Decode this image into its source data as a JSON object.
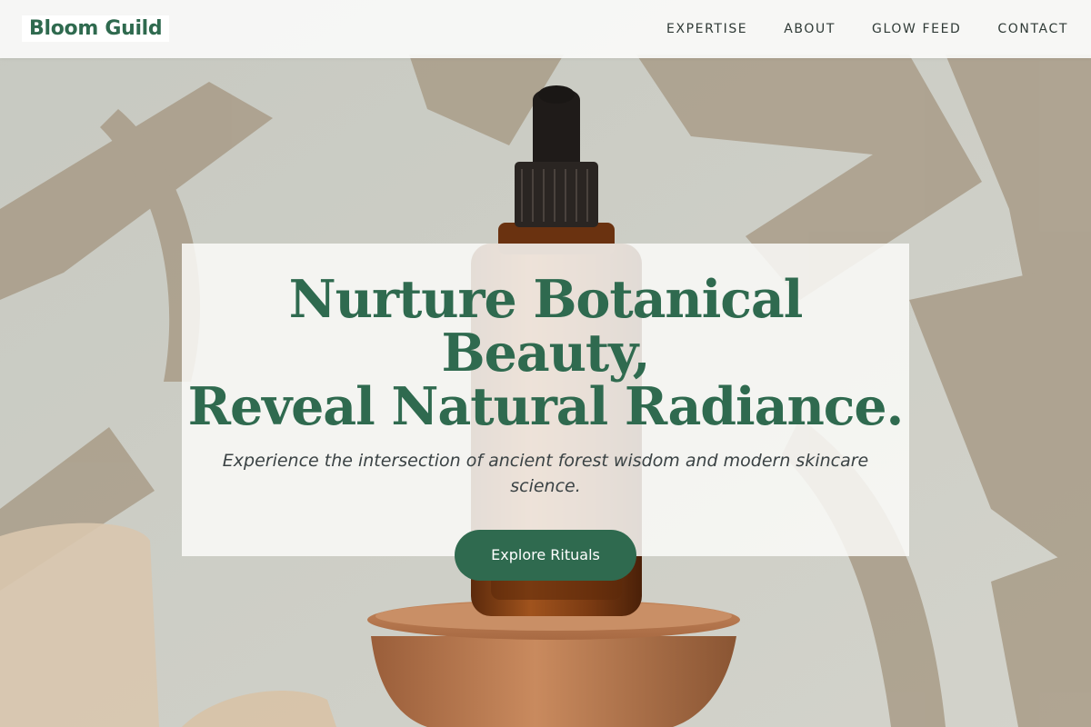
{
  "header": {
    "logo": "Bloom Guild",
    "nav": [
      "EXPERTISE",
      "ABOUT",
      "GLOW FEED",
      "CONTACT"
    ]
  },
  "hero": {
    "title": "Nurture Botanical Beauty,\nReveal Natural Radiance.",
    "subtitle": "Experience the intersection of ancient forest wisdom and modern skincare science.",
    "cta_label": "Explore Rituals"
  },
  "colors": {
    "brand_green": "#2f6a4f",
    "header_bg": "#fafaf9",
    "wall": "#cfd0c8",
    "shadow": "#a89b88",
    "amber_bottle": "#7a3a12",
    "wood": "#b47a52"
  }
}
